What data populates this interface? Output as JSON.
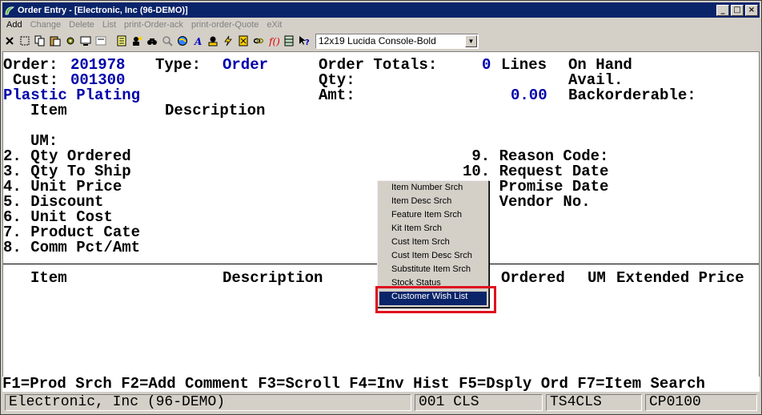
{
  "window": {
    "title": "Order Entry - [Electronic, Inc (96-DEMO)]",
    "controls": [
      "_",
      "□",
      "×"
    ]
  },
  "menu": [
    {
      "label": "Add",
      "active": true
    },
    {
      "label": "Change",
      "active": false
    },
    {
      "label": "Delete",
      "active": false
    },
    {
      "label": "List",
      "active": false
    },
    {
      "label": "print-Order-ack",
      "active": false
    },
    {
      "label": "print-order-Quote",
      "active": false
    },
    {
      "label": "eXit",
      "active": false
    }
  ],
  "toolbar": {
    "font_select_value": "12x19 Lucida Console-Bold"
  },
  "header": {
    "order_label": "Order:",
    "order_value": "201978",
    "type_label": "Type:",
    "type_value": "Order",
    "cust_label": "Cust:",
    "cust_value": "001300",
    "company": "Plastic Plating",
    "order_totals_label": "Order Totals:",
    "qty_label": "Qty:",
    "amt_label": "Amt:",
    "lines_count": "0",
    "lines_label": "Lines",
    "amt_value": "0.00",
    "on_hand_label": "On Hand",
    "avail_label": "Avail.",
    "backorderable_label": "Backorderable:"
  },
  "item_section": {
    "item_label": "Item",
    "description_label": "Description",
    "um_label": "UM:",
    "fields_left": [
      "2. Qty Ordered",
      "3. Qty To Ship",
      "4. Unit Price",
      "5. Discount",
      "6. Unit Cost",
      "7. Product Cate",
      "8. Comm Pct/Amt"
    ],
    "fields_right": [
      " 9. Reason Code:",
      "10. Request Date",
      "    Promise Date",
      "    Vendor No."
    ]
  },
  "lines_table": {
    "headers": [
      "Item",
      "Description",
      "Ordered",
      "UM",
      "Extended Price"
    ]
  },
  "context_menu": {
    "items": [
      "Item Number Srch",
      "Item Desc Srch",
      "Feature Item Srch",
      "Kit Item Srch",
      "Cust Item Srch",
      "Cust Item Desc Srch",
      "Substitute Item Srch",
      "Stock Status",
      "Customer Wish List"
    ],
    "selected_index": 8
  },
  "function_keys": "F1=Prod Srch F2=Add Comment F3=Scroll F4=Inv Hist F5=Dsply Ord F7=Item Search",
  "statusbar": {
    "company": "Electronic, Inc (96-DEMO)",
    "location": "001 CLS",
    "terminal": "TS4CLS",
    "program": "CP0100"
  },
  "colors": {
    "titlebar": "#0a246a",
    "field_value": "#0000aa",
    "highlight_box": "#e01020"
  }
}
